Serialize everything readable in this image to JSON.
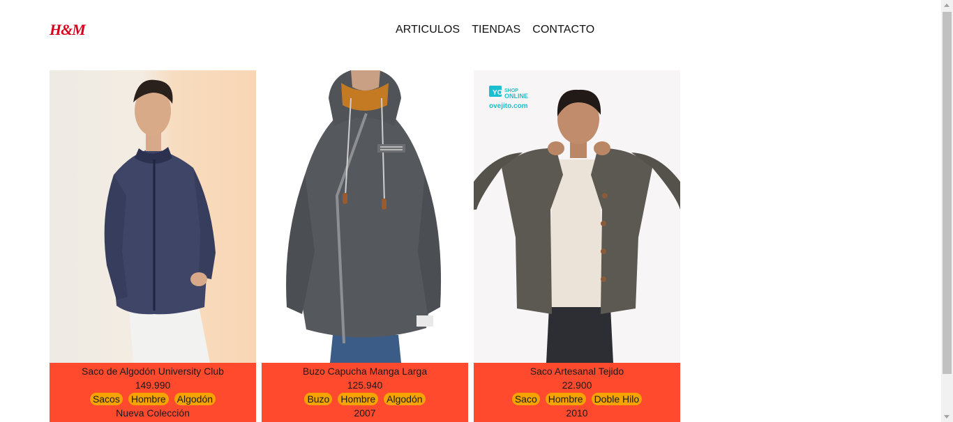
{
  "brand": {
    "logo_text": "H&M",
    "color": "#d6001c"
  },
  "nav": {
    "items": [
      "ARTICULOS",
      "TIENDAS",
      "CONTACTO"
    ]
  },
  "colors": {
    "card_info_bg": "#ff4a2e",
    "tag_bg": "#f5a300"
  },
  "products": [
    {
      "name": "Saco de Algodón University Club",
      "price": "149.990",
      "tags": [
        "Sacos",
        "Hombre",
        "Algodón"
      ],
      "footer": "Nueva Colección",
      "image": "man-navy-zip-cardigan-photo"
    },
    {
      "name": "Buzo Capucha Manga Larga",
      "price": "125.940",
      "tags": [
        "Buzo",
        "Hombre",
        "Algodón"
      ],
      "footer": "2007",
      "image": "grey-hooded-zip-jacket-photo"
    },
    {
      "name": "Saco Artesanal Tejido",
      "price": "22.900",
      "tags": [
        "Saco",
        "Hombre",
        "Doble Hilo"
      ],
      "footer": "2010",
      "image": "man-knit-cardigan-photo",
      "watermark": {
        "line1": "SHOP",
        "line2": "ONLINE",
        "site": "ovejito.com"
      }
    }
  ]
}
